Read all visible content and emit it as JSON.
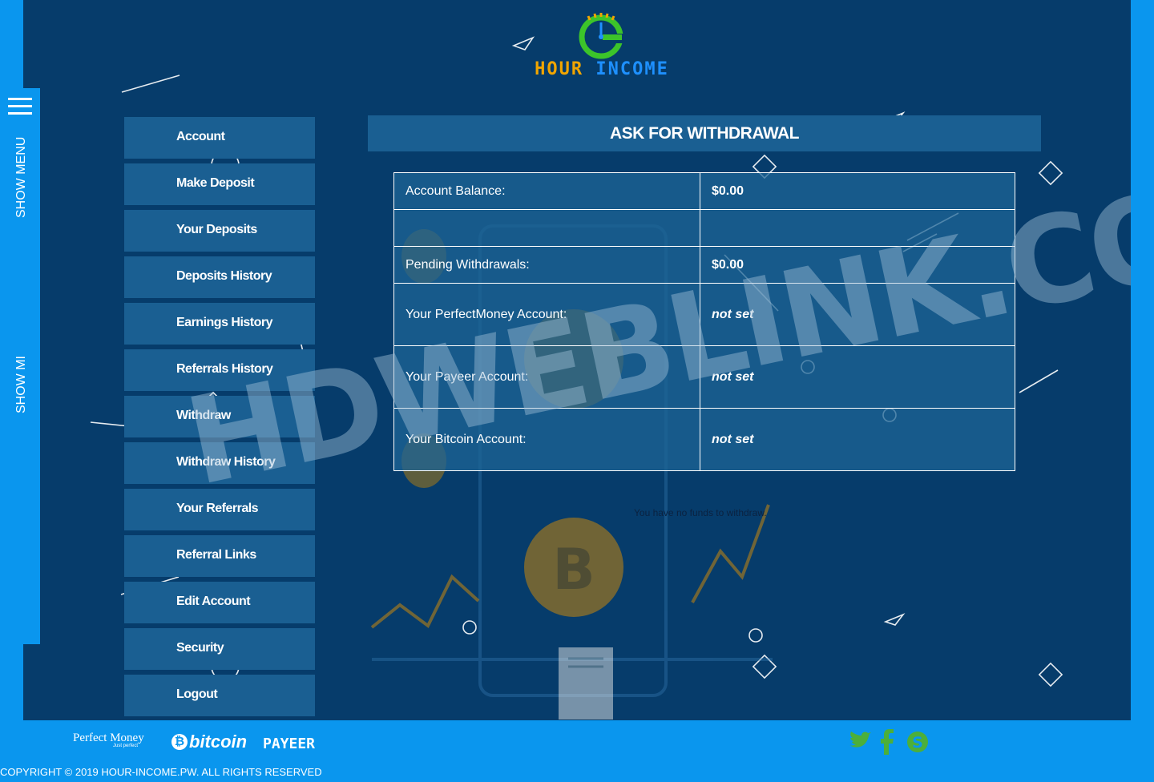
{
  "brand": {
    "hour": "HOUR",
    "income": "INCOME"
  },
  "side_tab": {
    "label_top": "SHOW MENU",
    "label_bottom": "SHOW MI"
  },
  "menu": [
    {
      "label": "Account"
    },
    {
      "label": "Make Deposit"
    },
    {
      "label": "Your Deposits"
    },
    {
      "label": "Deposits History"
    },
    {
      "label": "Earnings History"
    },
    {
      "label": "Referrals History"
    },
    {
      "label": "Withdraw"
    },
    {
      "label": "Withdraw History"
    },
    {
      "label": "Your Referrals"
    },
    {
      "label": "Referral Links"
    },
    {
      "label": "Edit Account"
    },
    {
      "label": "Security"
    },
    {
      "label": "Logout"
    }
  ],
  "main": {
    "title": "ASK FOR WITHDRAWAL",
    "rows": [
      {
        "label": "Account Balance:",
        "value": "$0.00"
      },
      {
        "label": "",
        "value": ""
      },
      {
        "label": "Pending Withdrawals:",
        "value": "$0.00"
      },
      {
        "label": "Your PerfectMoney Account:",
        "value": "not set"
      },
      {
        "label": "Your Payeer Account:",
        "value": "not set"
      },
      {
        "label": "Your Bitcoin Account:",
        "value": "not set"
      }
    ],
    "note": "You have no funds to withdraw."
  },
  "watermark": "HDWEBLINK.COM",
  "footer": {
    "perfect_money": "Perfect Money",
    "perfect_money_tag": "Just perfect",
    "bitcoin": "bitcoin",
    "payeer": "PAYEER",
    "copyright": "COPYRIGHT © 2019 HOUR-INCOME.PW. ALL RIGHTS RESERVED"
  },
  "colors": {
    "page_bg": "#0a96ee",
    "panel_bg": "#063c6b",
    "menu_bg": "#1a5f92",
    "logo_orange": "#f0a500",
    "logo_blue": "#1e90ff",
    "logo_green": "#3cc42a"
  },
  "icons": [
    "hamburger-icon",
    "twitter-icon",
    "facebook-icon",
    "skype-icon"
  ]
}
